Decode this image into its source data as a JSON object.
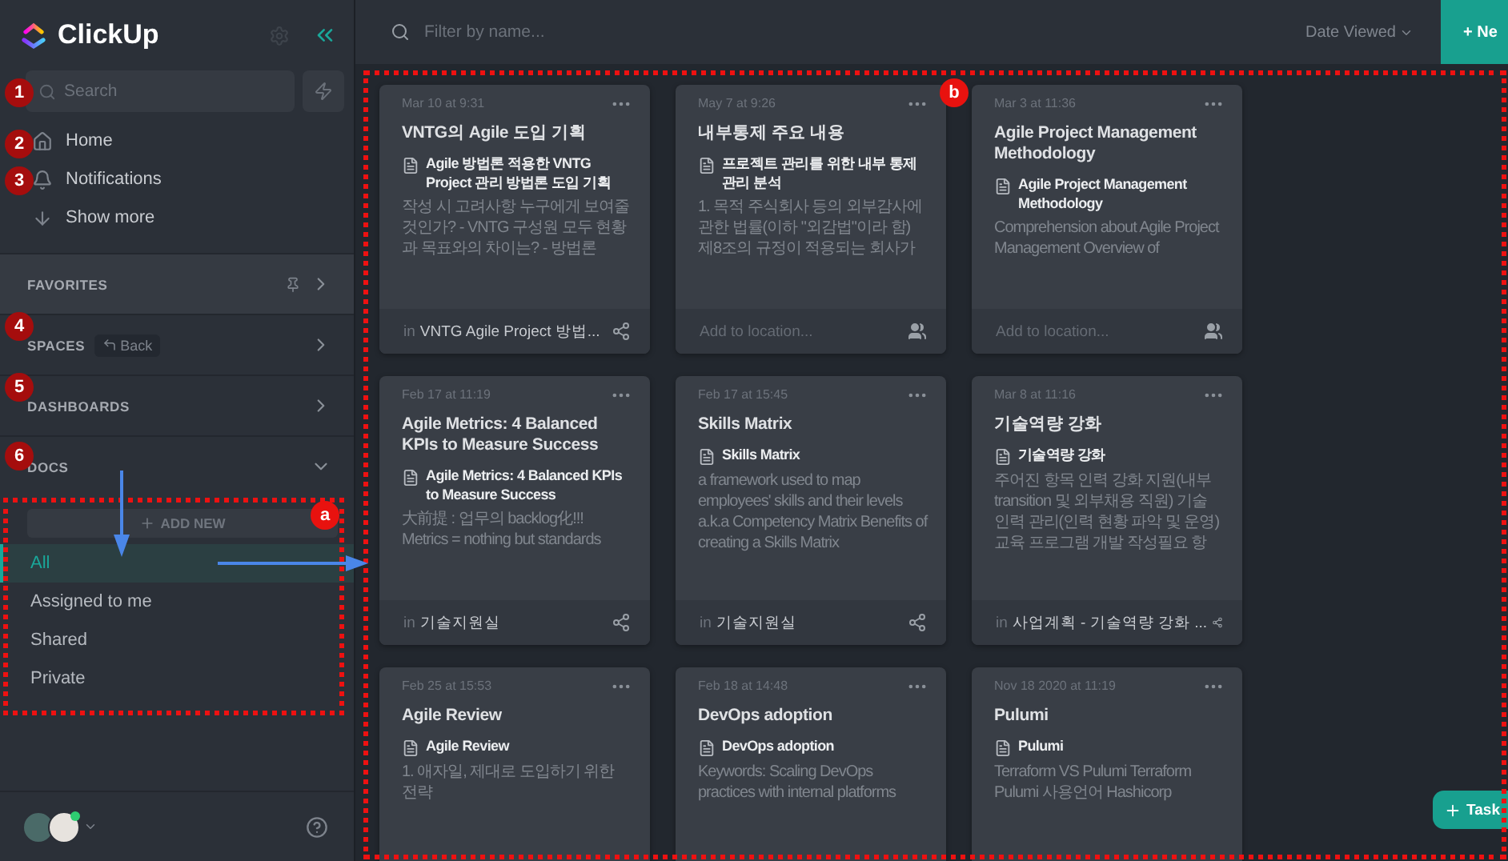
{
  "app": {
    "logo": "ClickUp"
  },
  "search": {
    "placeholder": "Search"
  },
  "nav": [
    {
      "label": "Home"
    },
    {
      "label": "Notifications"
    },
    {
      "label": "Show more"
    }
  ],
  "sections": [
    {
      "label": "FAVORITES",
      "kind": "favorites"
    },
    {
      "label": "SPACES",
      "kind": "spaces",
      "back": "Back"
    },
    {
      "label": "DASHBOARDS",
      "kind": "plain"
    },
    {
      "label": "DOCS",
      "kind": "docs",
      "expanded": true
    }
  ],
  "docs_panel": {
    "add_button": "ADD NEW",
    "filters": [
      {
        "label": "All",
        "selected": true
      },
      {
        "label": "Assigned to me",
        "selected": false
      },
      {
        "label": "Shared",
        "selected": false
      },
      {
        "label": "Private",
        "selected": false
      }
    ]
  },
  "user": {
    "online": true
  },
  "header": {
    "filter_placeholder": "Filter by name...",
    "sort": "Date Viewed",
    "new_button": "+ Ne"
  },
  "cards": [
    {
      "date": "Mar 10 at 9:31",
      "title": "VNTG의 Agile 도입 기획",
      "doc": "Agile 방법론 적용한 VNTG Project 관리 방법론 도입 기획",
      "preview": "작성 시 고려사항 누구에게 보여줄 것인가? - VNTG 구성원 모두 현황과 목표와의 차이는? - 방법론",
      "footer": {
        "kind": "location",
        "prefix": "in",
        "text": "VNTG Agile Project 방법..."
      }
    },
    {
      "date": "May 7 at 9:26",
      "title": "내부통제 주요 내용",
      "doc": "프로젝트 관리를 위한 내부 통제 관리 분석",
      "preview": "1. 목적 주식회사 등의 외부감사에 관한 법률(이하 \"외감법\"이라 함) 제8조의 규정이 적용되는 회사가",
      "footer": {
        "kind": "add",
        "text": "Add to location..."
      }
    },
    {
      "date": "Mar 3 at 11:36",
      "title": "Agile Project Management Methodology",
      "doc": "Agile Project Management Methodology",
      "preview": "Comprehension about Agile Project Management Overview of",
      "footer": {
        "kind": "add",
        "text": "Add to location..."
      }
    },
    {
      "date": "Feb 17 at 11:19",
      "title": "Agile Metrics: 4 Balanced KPIs to Measure Success",
      "doc": "Agile Metrics: 4 Balanced KPIs to Measure Success",
      "preview": "大前提 : 업무의 backlog化!!! Metrics = nothing but standards",
      "footer": {
        "kind": "location",
        "prefix": "in",
        "text": "기술지원실"
      }
    },
    {
      "date": "Feb 17 at 15:45",
      "title": "Skills Matrix",
      "doc": "Skills Matrix",
      "preview": "a framework used to map employees' skills and their levels a.k.a Competency Matrix Benefits of creating a Skills Matrix",
      "footer": {
        "kind": "location",
        "prefix": "in",
        "text": "기술지원실"
      }
    },
    {
      "date": "Mar 8 at 11:16",
      "title": "기술역량 강화",
      "doc": "기술역량 강화",
      "preview": "주어진 항목 인력 강화 지원(내부 transition 및 외부채용 직원) 기술 인력 관리(인력 현황 파악 및 운영) 교육 프로그램 개발 작성필요 항",
      "footer": {
        "kind": "location",
        "prefix": "in",
        "text": "사업계획 - 기술역량 강화 ..."
      }
    },
    {
      "date": "Feb 25 at 15:53",
      "title": "Agile Review",
      "doc": "Agile Review",
      "preview": "1. 애자일, 제대로 도입하기 위한 전략"
    },
    {
      "date": "Feb 18 at 14:48",
      "title": "DevOps adoption",
      "doc": "DevOps adoption",
      "preview": "Keywords: Scaling DevOps practices with internal platforms"
    },
    {
      "date": "Nov 18 2020 at 11:19",
      "title": "Pulumi",
      "doc": "Pulumi",
      "preview": "Terraform VS Pulumi Terraform Pulumi 사용언어 Hashicorp"
    }
  ],
  "task_button": "Task",
  "annotations": {
    "numbers": [
      "1",
      "2",
      "3",
      "4",
      "5",
      "6"
    ],
    "letters": [
      "a",
      "b"
    ]
  }
}
